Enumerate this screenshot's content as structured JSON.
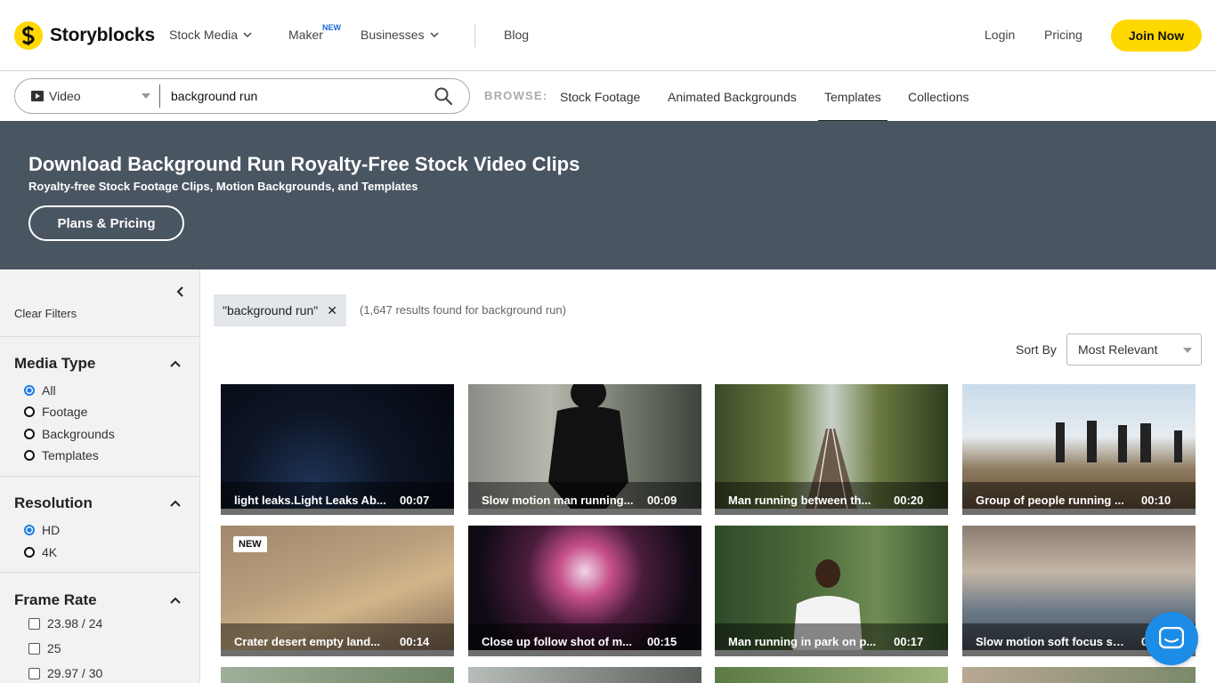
{
  "nav": {
    "logo_text": "Storyblocks",
    "stock_media": "Stock Media",
    "maker": "Maker",
    "maker_badge": "NEW",
    "businesses": "Businesses",
    "blog": "Blog",
    "login": "Login",
    "pricing": "Pricing",
    "join": "Join Now"
  },
  "search": {
    "media_type": "Video",
    "query": "background run",
    "browse_label": "BROWSE:",
    "browse_links": [
      "Stock Footage",
      "Animated Backgrounds",
      "Templates",
      "Collections"
    ]
  },
  "hero": {
    "title": "Download Background Run Royalty-Free Stock Video Clips",
    "subtitle": "Royalty-free Stock Footage Clips, Motion Backgrounds, and Templates",
    "button": "Plans & Pricing"
  },
  "sidebar": {
    "clear_filters": "Clear Filters",
    "media_type": {
      "title": "Media Type",
      "options": [
        "All",
        "Footage",
        "Backgrounds",
        "Templates"
      ],
      "selected": "All"
    },
    "resolution": {
      "title": "Resolution",
      "options": [
        "HD",
        "4K"
      ],
      "selected": "HD"
    },
    "frame_rate": {
      "title": "Frame Rate",
      "options": [
        "23.98 / 24",
        "25",
        "29.97 / 30"
      ]
    }
  },
  "results": {
    "chip": "\"background run\"",
    "count_text": "(1,647 results found for background run)",
    "sort_label": "Sort By",
    "sort_value": "Most Relevant",
    "new_badge": "NEW",
    "items": [
      {
        "title": "light leaks.Light Leaks Ab...",
        "duration": "00:07"
      },
      {
        "title": "Slow motion man running...",
        "duration": "00:09"
      },
      {
        "title": "Man running between th...",
        "duration": "00:20"
      },
      {
        "title": "Group of people running ...",
        "duration": "00:10"
      },
      {
        "title": "Crater desert empty land...",
        "duration": "00:14"
      },
      {
        "title": "Close up follow shot of m...",
        "duration": "00:15"
      },
      {
        "title": "Man running in park on p...",
        "duration": "00:17"
      },
      {
        "title": "Slow motion soft focus sh...",
        "duration": "0"
      }
    ]
  }
}
